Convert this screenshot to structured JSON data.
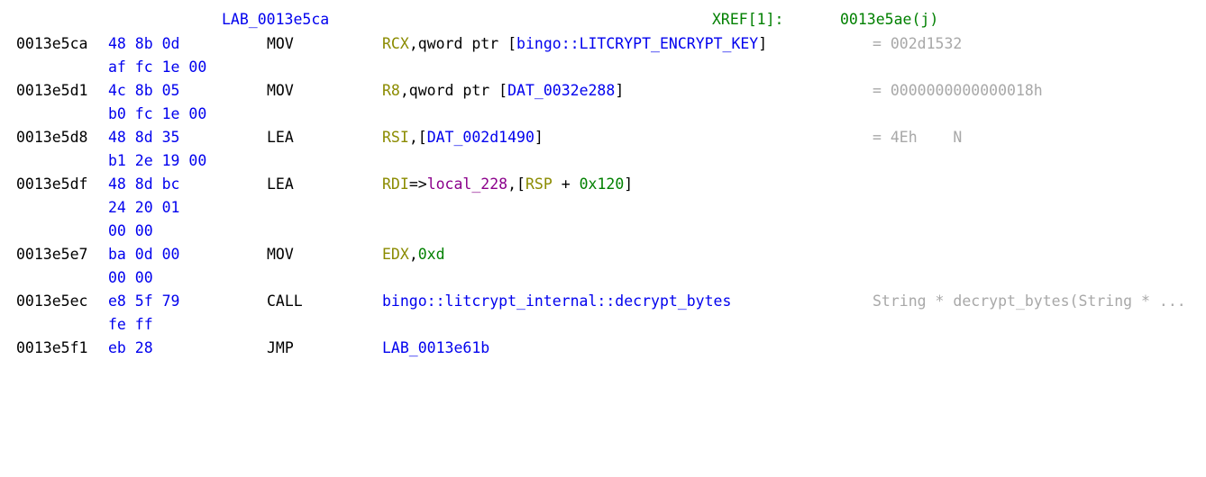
{
  "listing": {
    "label": "LAB_0013e5ca",
    "xref_label": "XREF[1]:",
    "xref_target": "0013e5ae(j)",
    "rows": [
      {
        "address": "0013e5ca",
        "bytes_1": "48 8b 0d",
        "bytes_2": "af fc 1e 00",
        "mnemonic": "MOV",
        "op_reg": "RCX",
        "op_mid": ",qword ptr [",
        "op_sym": "bingo::LITCRYPT_ENCRYPT_KEY",
        "op_end": "]",
        "comment": "= 002d1532"
      },
      {
        "address": "0013e5d1",
        "bytes_1": "4c 8b 05",
        "bytes_2": "b0 fc 1e 00",
        "mnemonic": "MOV",
        "op_reg": "R8",
        "op_mid": ",qword ptr [",
        "op_sym": "DAT_0032e288",
        "op_end": "]",
        "comment": "= 0000000000000018h"
      },
      {
        "address": "0013e5d8",
        "bytes_1": "48 8d 35",
        "bytes_2": "b1 2e 19 00",
        "mnemonic": "LEA",
        "op_reg": "RSI",
        "op_mid": ",[",
        "op_sym": "DAT_002d1490",
        "op_end": "]",
        "comment": "= 4Eh    N"
      },
      {
        "address": "0013e5df",
        "bytes_1": "48 8d bc",
        "bytes_2": "24 20 01",
        "bytes_3": "00 00",
        "mnemonic": "LEA",
        "op_reg": "RDI",
        "op_arrow": "=>",
        "op_local": "local_228",
        "op_mid": ",[",
        "op_reg2": "RSP",
        "op_plus": " + ",
        "op_num": "0x120",
        "op_end": "]"
      },
      {
        "address": "0013e5e7",
        "bytes_1": "ba 0d 00",
        "bytes_2": "00 00",
        "mnemonic": "MOV",
        "op_reg": "EDX",
        "op_comma": ",",
        "op_num": "0xd"
      },
      {
        "address": "0013e5ec",
        "bytes_1": "e8 5f 79",
        "bytes_2": "fe ff",
        "mnemonic": "CALL",
        "op_sym": "bingo::litcrypt_internal::decrypt_bytes",
        "comment": "String * decrypt_bytes(String * ..."
      },
      {
        "address": "0013e5f1",
        "bytes_1": "eb 28",
        "mnemonic": "JMP",
        "op_sym": "LAB_0013e61b"
      }
    ]
  },
  "colors": {
    "background": "#ffffff",
    "address": "#000000",
    "bytes": "#0000ee",
    "register": "#8b8b00",
    "label": "#0000ee",
    "local_var": "#8b008b",
    "number": "#008000",
    "xref": "#008000",
    "comment": "#a8a8a8"
  }
}
